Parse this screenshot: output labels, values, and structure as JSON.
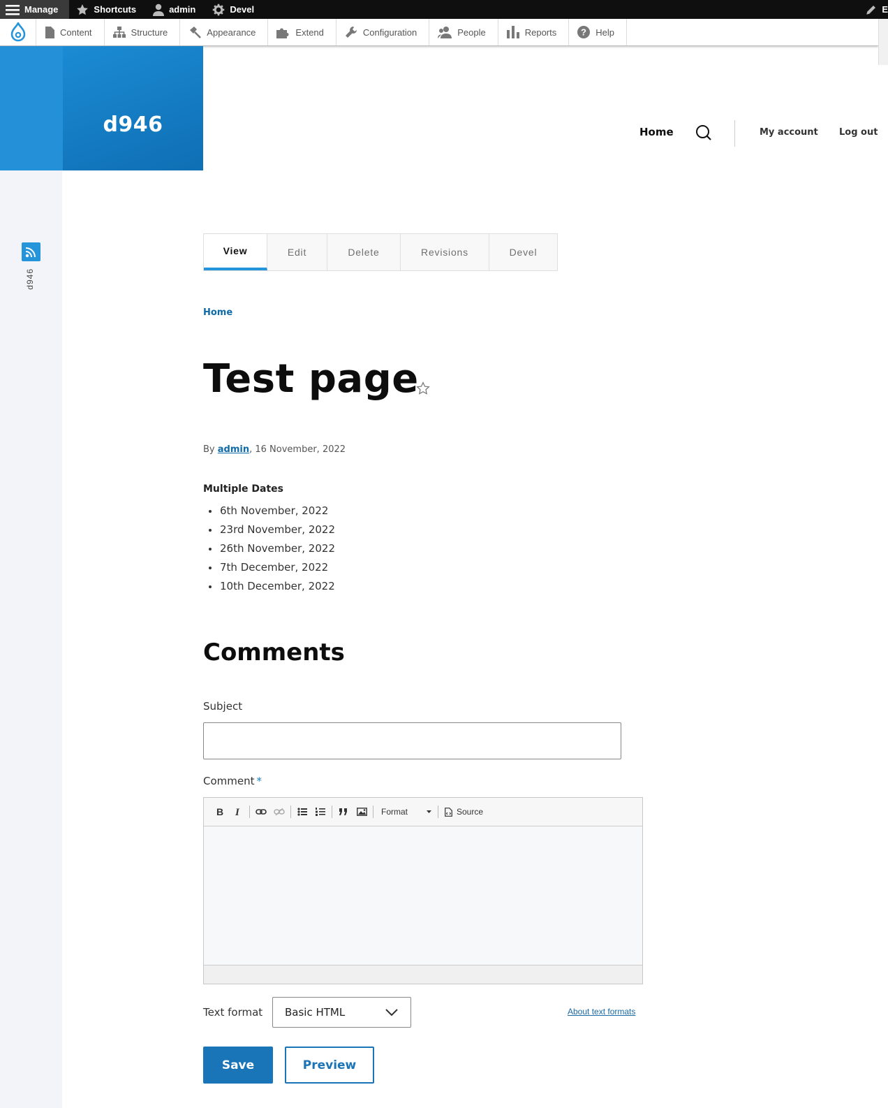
{
  "toolbar": {
    "manage_label": "Manage",
    "shortcuts_label": "Shortcuts",
    "user_label": "admin",
    "devel_label": "Devel",
    "edit_label": "E"
  },
  "tray": {
    "items": [
      {
        "label": "Content",
        "icon": "file-icon"
      },
      {
        "label": "Structure",
        "icon": "sitemap-icon"
      },
      {
        "label": "Appearance",
        "icon": "paintbrush-icon"
      },
      {
        "label": "Extend",
        "icon": "puzzle-icon"
      },
      {
        "label": "Configuration",
        "icon": "wrench-icon"
      },
      {
        "label": "People",
        "icon": "people-icon"
      },
      {
        "label": "Reports",
        "icon": "bar-chart-icon"
      },
      {
        "label": "Help",
        "icon": "help-icon"
      }
    ]
  },
  "site": {
    "name": "d946"
  },
  "sidebar": {
    "label": "d946"
  },
  "nav": {
    "home": "Home",
    "my_account": "My account",
    "logout": "Log out"
  },
  "tabs": [
    {
      "label": "View",
      "active": true
    },
    {
      "label": "Edit",
      "active": false
    },
    {
      "label": "Delete",
      "active": false
    },
    {
      "label": "Revisions",
      "active": false
    },
    {
      "label": "Devel",
      "active": false
    }
  ],
  "breadcrumb": {
    "home": "Home"
  },
  "page": {
    "title": "Test page",
    "byline_prefix": "By",
    "author": "admin",
    "date": ", 16 November, 2022"
  },
  "field": {
    "label": "Multiple Dates",
    "dates": [
      "6th November, 2022",
      "23rd November, 2022",
      "26th November, 2022",
      "7th December, 2022",
      "10th December, 2022"
    ]
  },
  "comments": {
    "title": "Comments",
    "subject_label": "Subject",
    "subject_value": "",
    "comment_label": "Comment",
    "required_marker": "*",
    "editor": {
      "format_label": "Format",
      "source_label": "Source"
    },
    "text_format_label": "Text format",
    "text_format_value": "Basic HTML",
    "about_formats": "About text formats",
    "save_label": "Save",
    "preview_label": "Preview"
  },
  "colors": {
    "accent": "#2494db",
    "brand_dark": "#0f6fb4",
    "button": "#1a74b8"
  }
}
